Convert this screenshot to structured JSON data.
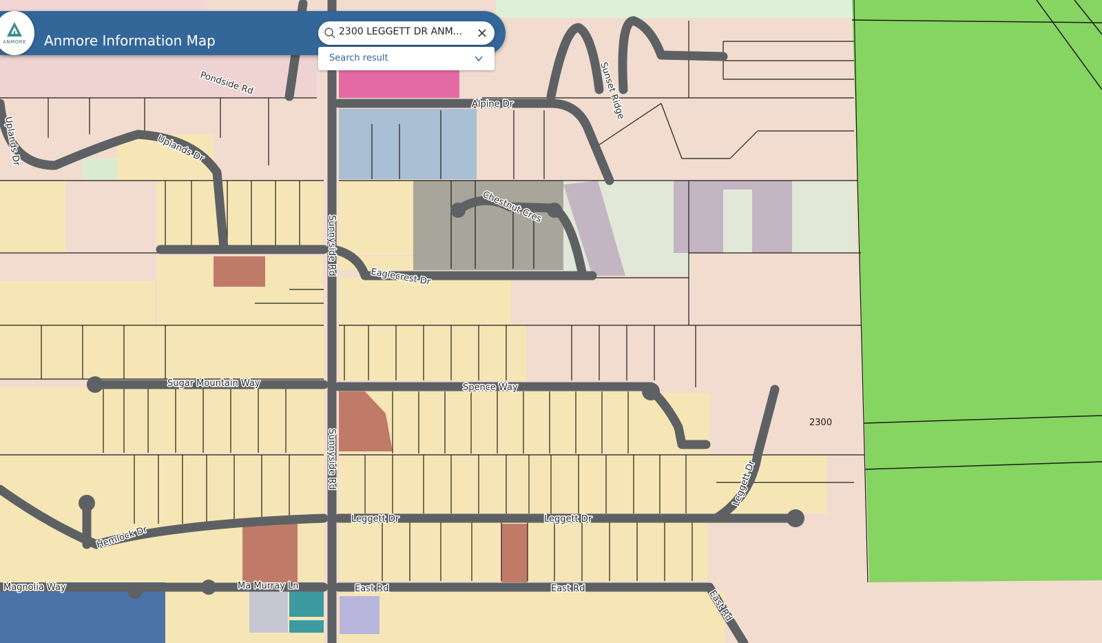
{
  "app": {
    "title": "Anmore Information Map",
    "logo_text": "ANMORE",
    "logo_icon": "mountain-tree-icon"
  },
  "search": {
    "value": "2300 LEGGETT DR ANMORE",
    "display": "2300 LEGGETT DR ANM...",
    "icon": "search-icon",
    "clear_icon": "close-icon"
  },
  "results": {
    "label": "Search result",
    "icon": "chevron-down-icon"
  },
  "map": {
    "address_label": "2300",
    "roads": {
      "alpine": "Alpine Dr",
      "sunset": "Sunset Ridge",
      "uplands_a": "Uplands Dr",
      "uplands_b": "Uplands Dr",
      "pondside": "Pondside Rd",
      "chestnut": "Chestnut Cres",
      "eaglecrest": "Eaglecrest Dr",
      "sunnyside_a": "Sunnyside Rd",
      "sunnyside_b": "Sunnyside Rd",
      "sugar": "Sugar Mountain Way",
      "spence": "Spence Way",
      "leggett_a": "Leggett Dr",
      "leggett_b": "Leggett Dr",
      "leggett_c": "Leggett Dr",
      "hemlock": "Hemlock Dr",
      "magnolia": "Magnolia Way",
      "mcmurray": "Ma Murray Ln",
      "east_a": "East Rd",
      "east_b": "East Rd",
      "east_c": "East Rd"
    },
    "colors": {
      "parkland": "#86d462",
      "residential": "#f7e6b5",
      "rural": "#f2dccf",
      "commercial": "#e46aa3",
      "institutional": "#a8bfd4",
      "comprehensive": "#a8a59a",
      "agricultural_light": "#e2e8d8",
      "mauve": "#c4b5c3",
      "brick": "#c07b68",
      "blue_lots": "#4a74a9",
      "teal": "#3c9ba1",
      "lavender": "#b8b5dd",
      "grey_lot": "#c6c6d2",
      "road": "#5e6163",
      "header": "#336699"
    }
  }
}
